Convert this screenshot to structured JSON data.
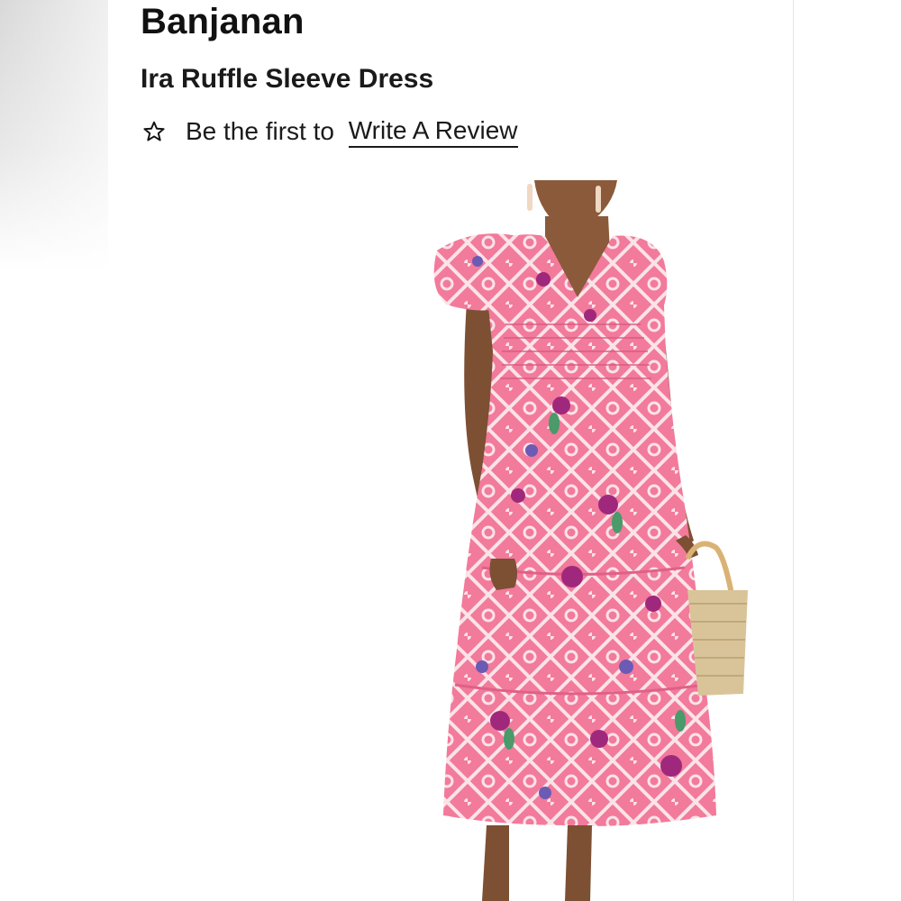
{
  "product": {
    "brand": "Banjanan",
    "name": "Ira Ruffle Sleeve Dress",
    "image_icon": "dress-photo"
  },
  "review": {
    "prefix": "Be the first to ",
    "link_label": "Write A Review",
    "icon": "star-outline-icon"
  },
  "colors": {
    "text": "#111111",
    "dress_pink": "#f27a9b",
    "dress_pattern": "#fbe3e8",
    "accent_purple": "#a0287c",
    "basket": "#d9c49a",
    "skin": "#8a5a3b"
  }
}
